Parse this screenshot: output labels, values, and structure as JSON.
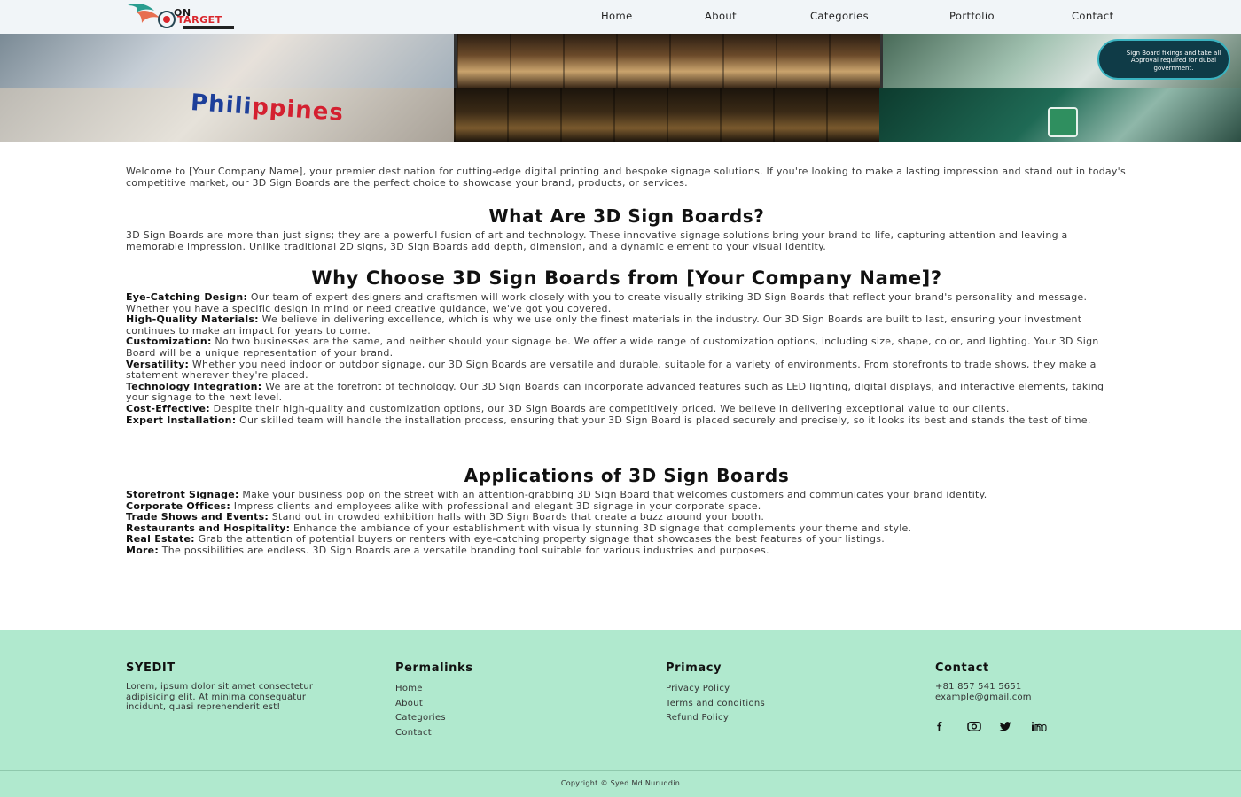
{
  "brand": {
    "logo_line1": "ON",
    "logo_line2": "TARGET",
    "brand_color": "#d9262c",
    "accent_colors": [
      "#2a9d8f",
      "#e76f51",
      "#264653"
    ]
  },
  "nav": {
    "items": [
      "Home",
      "About",
      "Categories",
      "Portfolio",
      "Contact"
    ]
  },
  "banner": {
    "philippines_text_1": "Phili",
    "philippines_text_2": "ppines",
    "bubble_text": "Sign Board fixings and take all Approval required for dubai government."
  },
  "content": {
    "intro": "Welcome to [Your Company Name], your premier destination for cutting-edge digital printing and bespoke signage solutions. If you're looking to make a lasting impression and stand out in today's competitive market, our 3D Sign Boards are the perfect choice to showcase your brand, products, or services.",
    "what_heading": "What Are 3D Sign Boards?",
    "what_text": "3D Sign Boards are more than just signs; they are a powerful fusion of art and technology. These innovative signage solutions bring your brand to life, capturing attention and leaving a memorable impression. Unlike traditional 2D signs, 3D Sign Boards add depth, dimension, and a dynamic element to your visual identity.",
    "why_heading": "Why Choose 3D Sign Boards from [Your Company Name]?",
    "why_items": [
      {
        "title": "Eye-Catching Design:",
        "text": " Our team of expert designers and craftsmen will work closely with you to create visually striking 3D Sign Boards that reflect your brand's personality and message. Whether you have a specific design in mind or need creative guidance, we've got you covered."
      },
      {
        "title": "High-Quality Materials:",
        "text": " We believe in delivering excellence, which is why we use only the finest materials in the industry. Our 3D Sign Boards are built to last, ensuring your investment continues to make an impact for years to come."
      },
      {
        "title": "Customization:",
        "text": " No two businesses are the same, and neither should your signage be. We offer a wide range of customization options, including size, shape, color, and lighting. Your 3D Sign Board will be a unique representation of your brand."
      },
      {
        "title": "Versatility:",
        "text": " Whether you need indoor or outdoor signage, our 3D Sign Boards are versatile and durable, suitable for a variety of environments. From storefronts to trade shows, they make a statement wherever they're placed."
      },
      {
        "title": "Technology Integration:",
        "text": " We are at the forefront of technology. Our 3D Sign Boards can incorporate advanced features such as LED lighting, digital displays, and interactive elements, taking your signage to the next level."
      },
      {
        "title": "Cost-Effective:",
        "text": " Despite their high-quality and customization options, our 3D Sign Boards are competitively priced. We believe in delivering exceptional value to our clients."
      },
      {
        "title": "Expert Installation:",
        "text": " Our skilled team will handle the installation process, ensuring that your 3D Sign Board is placed securely and precisely, so it looks its best and stands the test of time."
      }
    ],
    "apps_heading": "Applications of 3D Sign Boards",
    "apps_items": [
      {
        "title": "Storefront Signage:",
        "text": " Make your business pop on the street with an attention-grabbing 3D Sign Board that welcomes customers and communicates your brand identity."
      },
      {
        "title": "Corporate Offices:",
        "text": " Impress clients and employees alike with professional and elegant 3D signage in your corporate space."
      },
      {
        "title": "Trade Shows and Events:",
        "text": " Stand out in crowded exhibition halls with 3D Sign Boards that create a buzz around your booth."
      },
      {
        "title": "Restaurants and Hospitality:",
        "text": " Enhance the ambiance of your establishment with visually stunning 3D signage that complements your theme and style."
      },
      {
        "title": "Real Estate:",
        "text": " Grab the attention of potential buyers or renters with eye-catching property signage that showcases the best features of your listings."
      },
      {
        "title": "More:",
        "text": " The possibilities are endless. 3D Sign Boards are a versatile branding tool suitable for various industries and purposes."
      }
    ]
  },
  "footer": {
    "col1_title": "SYEDIT",
    "col1_text": "Lorem, ipsum dolor sit amet consectetur adipisicing elit. At minima consequatur incidunt, quasi reprehenderit est!",
    "col2_title": "Permalinks",
    "col2_links": [
      "Home",
      "About",
      "Categories",
      "Contact"
    ],
    "col3_title": "Primacy",
    "col3_links": [
      "Privacy Policy",
      "Terms and conditions",
      "Refund Policy"
    ],
    "col4_title": "Contact",
    "phone": "+81 857 541 5651",
    "email": "example@gmail.com",
    "social_icons": [
      "facebook-icon",
      "instagram-icon",
      "twitter-icon",
      "linkedin-icon"
    ],
    "copyright": "Copyright © Syed Md Nuruddin",
    "background": "#b0e9ce"
  }
}
